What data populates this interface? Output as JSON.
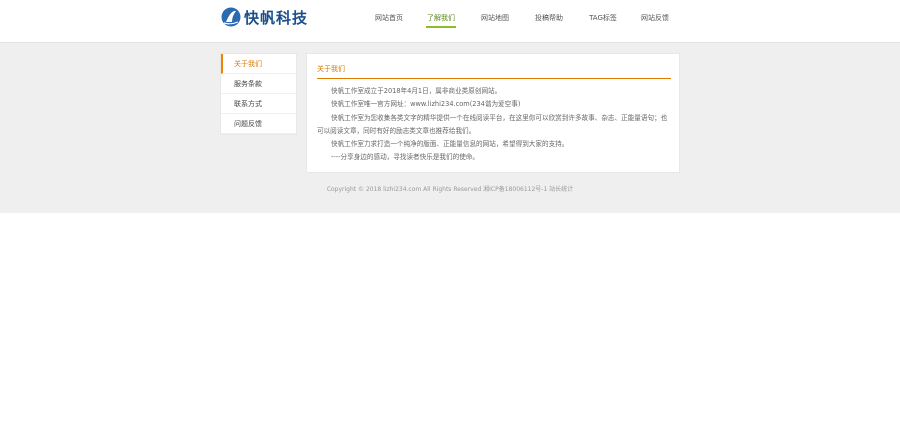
{
  "header": {
    "logo_text": "快帆科技",
    "nav": [
      {
        "label": "网站首页",
        "active": false
      },
      {
        "label": "了解我们",
        "active": true
      },
      {
        "label": "网站地图",
        "active": false
      },
      {
        "label": "投稿帮助",
        "active": false
      },
      {
        "label": "TAG标签",
        "active": false
      },
      {
        "label": "网站反馈",
        "active": false
      }
    ]
  },
  "sidebar": {
    "items": [
      {
        "label": "关于我们",
        "active": true
      },
      {
        "label": "服务条款",
        "active": false
      },
      {
        "label": "联系方式",
        "active": false
      },
      {
        "label": "问题反馈",
        "active": false
      }
    ]
  },
  "content": {
    "title": "关于我们",
    "paragraphs": [
      "快帆工作室成立于2018年4月1日，属非商业类原创网站。",
      "快帆工作室唯一官方网址：www.lizhi234.com(234谐为爱空事)",
      "快帆工作室为您收集各类文字的精华提供一个在线阅读平台，在这里你可以欣赏到许多故事、杂志、正能量语句；也可以阅读文章，同时有好的励志类文章也推荐给我们。",
      "快帆工作室力求打造一个纯净的版面、正能量信息的网站，希望得到大家的支持。",
      "----分享身边的感动，寻找读者快乐是我们的使命。"
    ]
  },
  "footer": {
    "text": "Copyright © 2018 lizhi234.com All Rights Reserved 湘ICP备18006112号-1 站长统计"
  },
  "colors": {
    "accent_orange": "#f08300",
    "nav_active_green": "#8bbf2a",
    "logo_blue": "#1b4f8c",
    "page_gray": "#efefef"
  }
}
